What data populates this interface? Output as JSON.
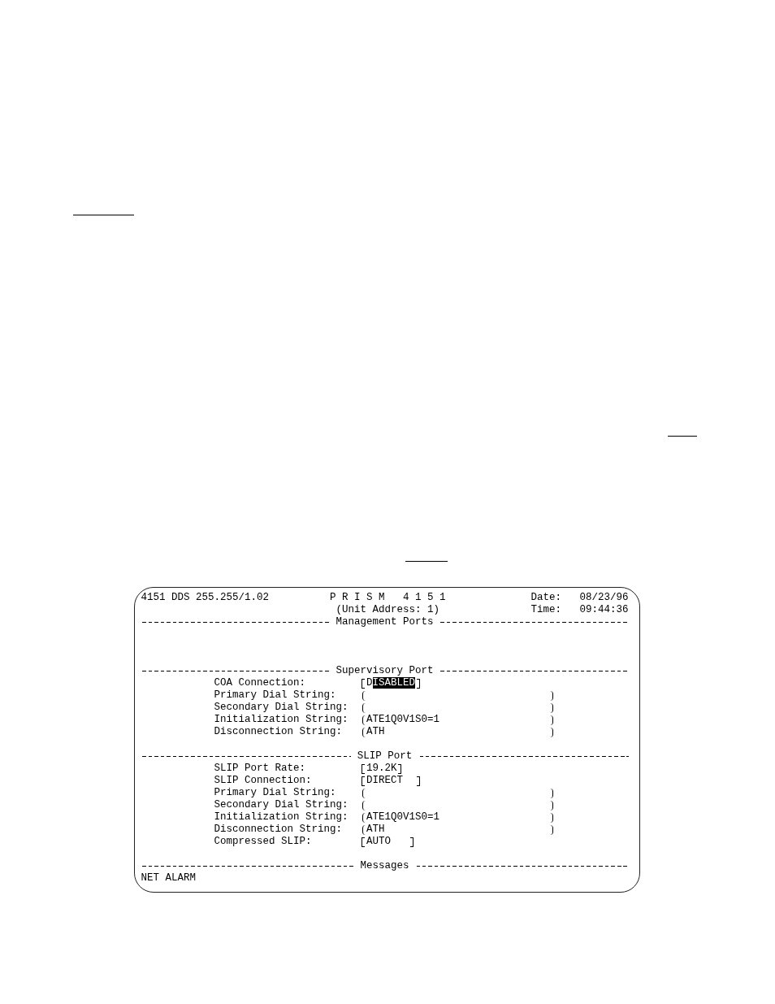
{
  "screen": {
    "header": {
      "device": "4151 DDS 255.255/1.02",
      "title": "P R I S M   4 1 5 1",
      "unit_address": "(Unit Address: 1)",
      "date_label": "Date:",
      "date": "08/23/96",
      "time_label": "Time:",
      "time": "09:44:36"
    },
    "sections": [
      {
        "kind": "blank",
        "title": "Management Ports"
      },
      {
        "kind": "form",
        "title": "Supervisory Port",
        "fields": [
          {
            "label": "COA Connection:",
            "kind": "choice",
            "value": "DISABLED",
            "selected": true
          },
          {
            "label": "Primary Dial String:",
            "kind": "string",
            "selected": false
          },
          {
            "label": "Secondary Dial String:",
            "kind": "string",
            "selected": false
          },
          {
            "label": "Initialization String:",
            "kind": "string",
            "value": "ATE1Q0V1S0=1",
            "selected": false
          },
          {
            "label": "Disconnection String:",
            "kind": "string",
            "value": "ATH",
            "selected": false
          }
        ]
      },
      {
        "kind": "form",
        "title": "SLIP Port",
        "fields": [
          {
            "label": "SLIP Port Rate:",
            "kind": "choice",
            "value": "19.2K",
            "selected": false
          },
          {
            "label": "SLIP Connection:",
            "kind": "choice",
            "value": "DIRECT  ",
            "selected": false
          },
          {
            "label": "Primary Dial String:",
            "kind": "string",
            "selected": false
          },
          {
            "label": "Secondary Dial String:",
            "kind": "string",
            "selected": false
          },
          {
            "label": "Initialization String:",
            "kind": "string",
            "value": "ATE1Q0V1S0=1",
            "selected": false
          },
          {
            "label": "Disconnection String:",
            "kind": "string",
            "value": "ATH",
            "selected": false
          },
          {
            "label": "Compressed SLIP:",
            "kind": "choice",
            "value": "AUTO   ",
            "selected": false
          }
        ]
      },
      {
        "kind": "messages",
        "title": "Messages",
        "lines": [
          "NET ALARM"
        ]
      }
    ]
  }
}
